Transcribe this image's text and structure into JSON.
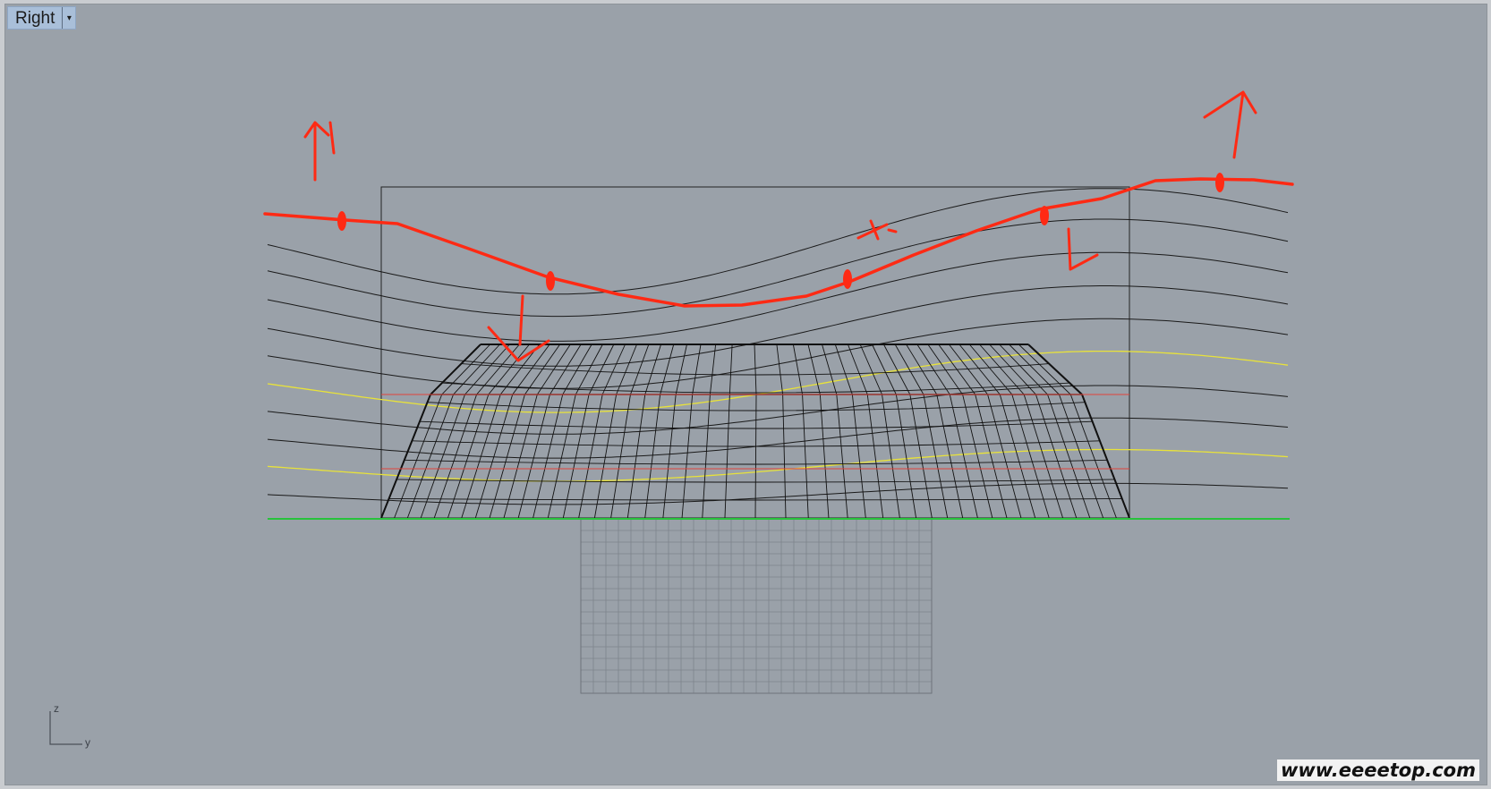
{
  "viewport": {
    "title": "Right",
    "dropdown_icon": "chevron-down-icon",
    "background": "#9aa1a9"
  },
  "axes": {
    "vertical": "z",
    "horizontal": "y"
  },
  "colors": {
    "guide_curve": "#1a1a1a",
    "highlight_curve": "#e8e23a",
    "section_line": "#e0443a",
    "base_line": "#28c23c",
    "annotation": "#ff2a14",
    "grid": "#7d848c"
  },
  "watermark": "www.eeeetop.com"
}
